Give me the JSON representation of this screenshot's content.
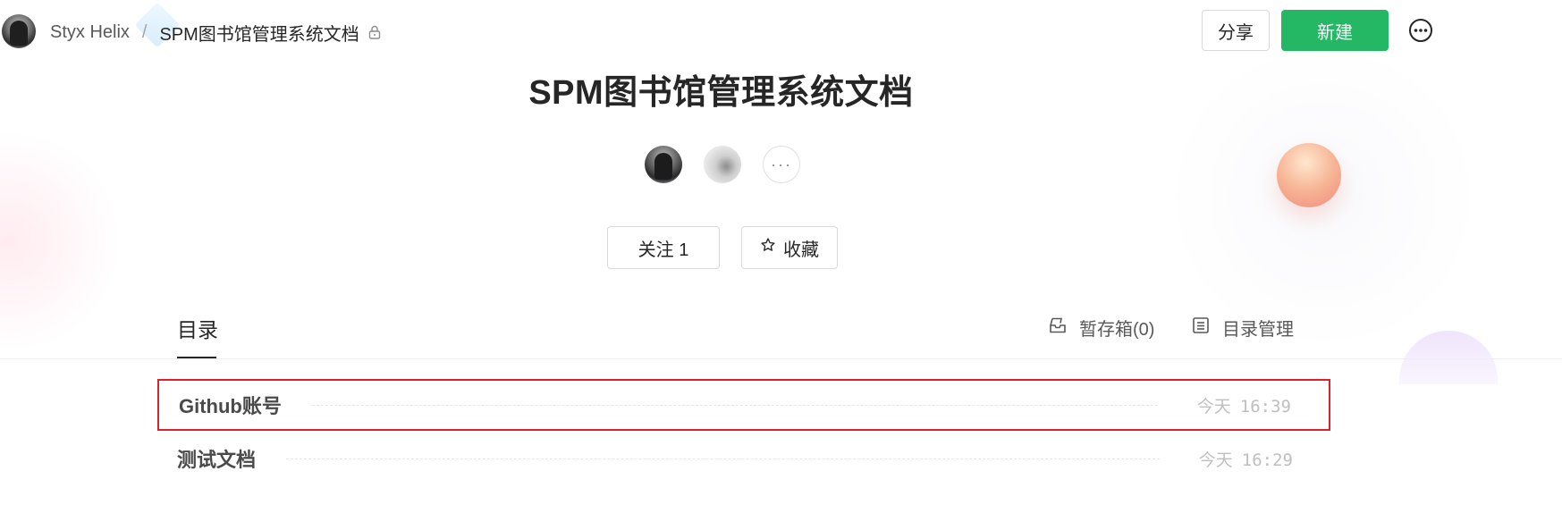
{
  "header": {
    "breadcrumb": {
      "owner": "Styx Helix",
      "separator": "/",
      "book": "SPM图书馆管理系统文档"
    },
    "share_label": "分享",
    "new_label": "新建"
  },
  "book": {
    "title": "SPM图书馆管理系统文档",
    "members_more": "···",
    "follow_label": "关注 1",
    "favorite_label": "收藏"
  },
  "tabs": {
    "toc_label": "目录",
    "drafts_label": "暂存箱(0)",
    "toc_manage_label": "目录管理"
  },
  "docs": [
    {
      "title": "Github账号",
      "date_label": "今天",
      "time": "16:39",
      "highlighted": true
    },
    {
      "title": "测试文档",
      "date_label": "今天",
      "time": "16:29",
      "highlighted": false
    }
  ],
  "colors": {
    "primary_green": "#25b864",
    "highlight_border": "#d9232c"
  },
  "icons": {
    "lock": "lock-icon",
    "more": "more-circle-icon",
    "star": "star-icon",
    "drafts": "inbox-icon",
    "toc_manage": "list-icon"
  }
}
